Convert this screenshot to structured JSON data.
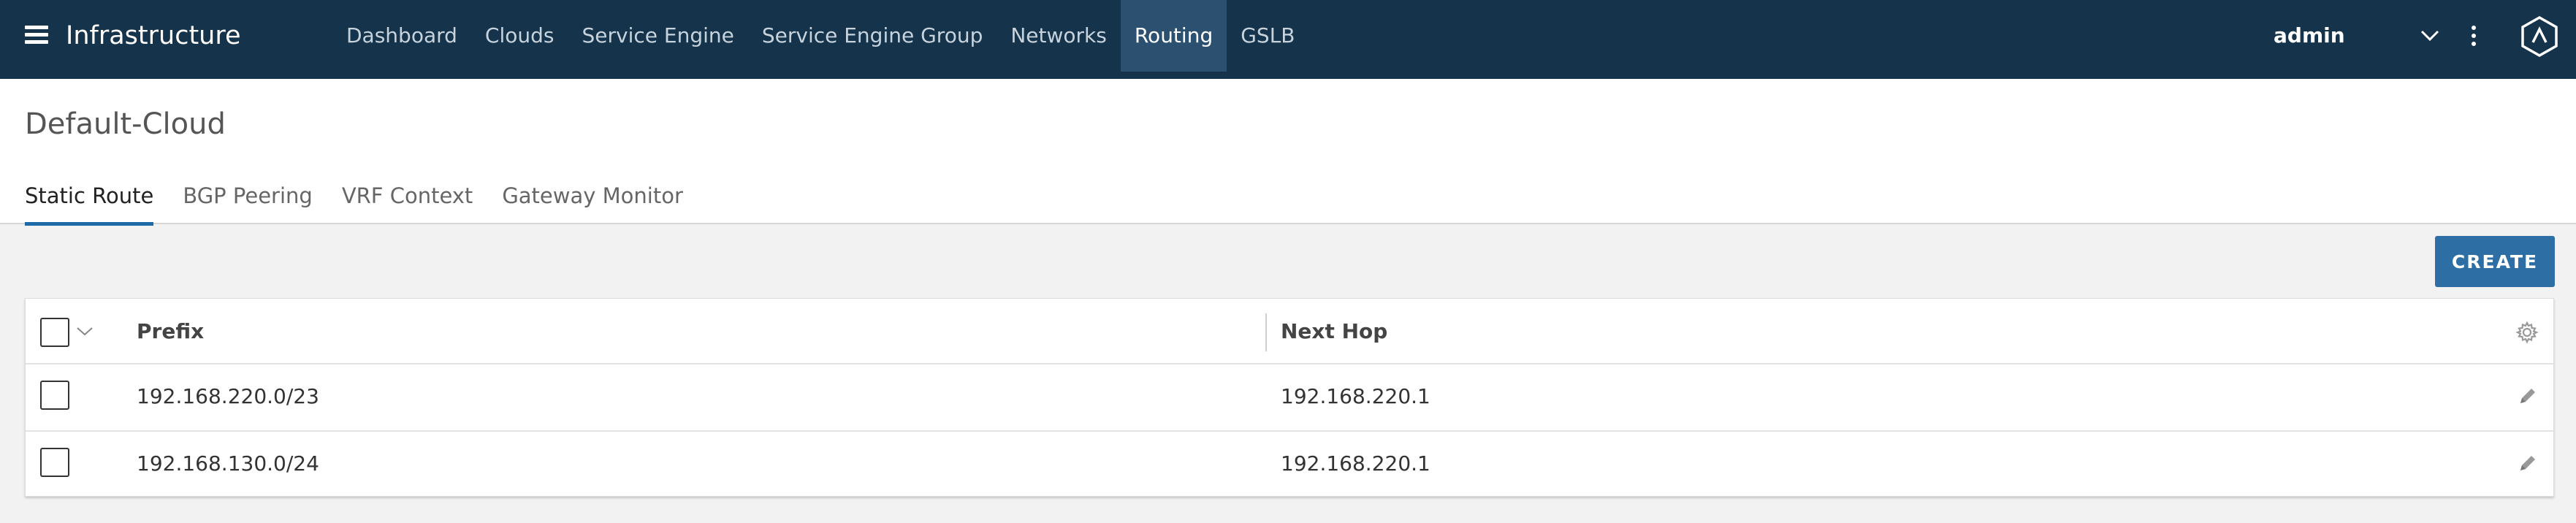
{
  "topbar": {
    "app_title": "Infrastructure",
    "nav": [
      {
        "label": "Dashboard",
        "active": false
      },
      {
        "label": "Clouds",
        "active": false
      },
      {
        "label": "Service Engine",
        "active": false
      },
      {
        "label": "Service Engine Group",
        "active": false
      },
      {
        "label": "Networks",
        "active": false
      },
      {
        "label": "Routing",
        "active": true
      },
      {
        "label": "GSLB",
        "active": false
      }
    ],
    "user": "admin",
    "icons": {
      "menu": "hamburger-menu-icon",
      "user_dropdown": "chevron-down-icon",
      "more": "kebab-menu-icon",
      "brand": "avi-logo-icon"
    }
  },
  "page": {
    "title": "Default-Cloud",
    "tabs": [
      {
        "label": "Static Route",
        "active": true
      },
      {
        "label": "BGP Peering",
        "active": false
      },
      {
        "label": "VRF Context",
        "active": false
      },
      {
        "label": "Gateway Monitor",
        "active": false
      }
    ]
  },
  "actions": {
    "create_label": "CREATE"
  },
  "table": {
    "columns": [
      "Prefix",
      "Next Hop"
    ],
    "rows": [
      {
        "prefix": "192.168.220.0/23",
        "next_hop": "192.168.220.1"
      },
      {
        "prefix": "192.168.130.0/24",
        "next_hop": "192.168.220.1"
      }
    ],
    "icons": {
      "settings": "gear-icon",
      "edit": "pencil-icon"
    }
  },
  "colors": {
    "topbar_bg": "#15334a",
    "active_nav_bg": "#2c5170",
    "accent": "#1e6aa6",
    "button_bg": "#2d6ea5"
  }
}
